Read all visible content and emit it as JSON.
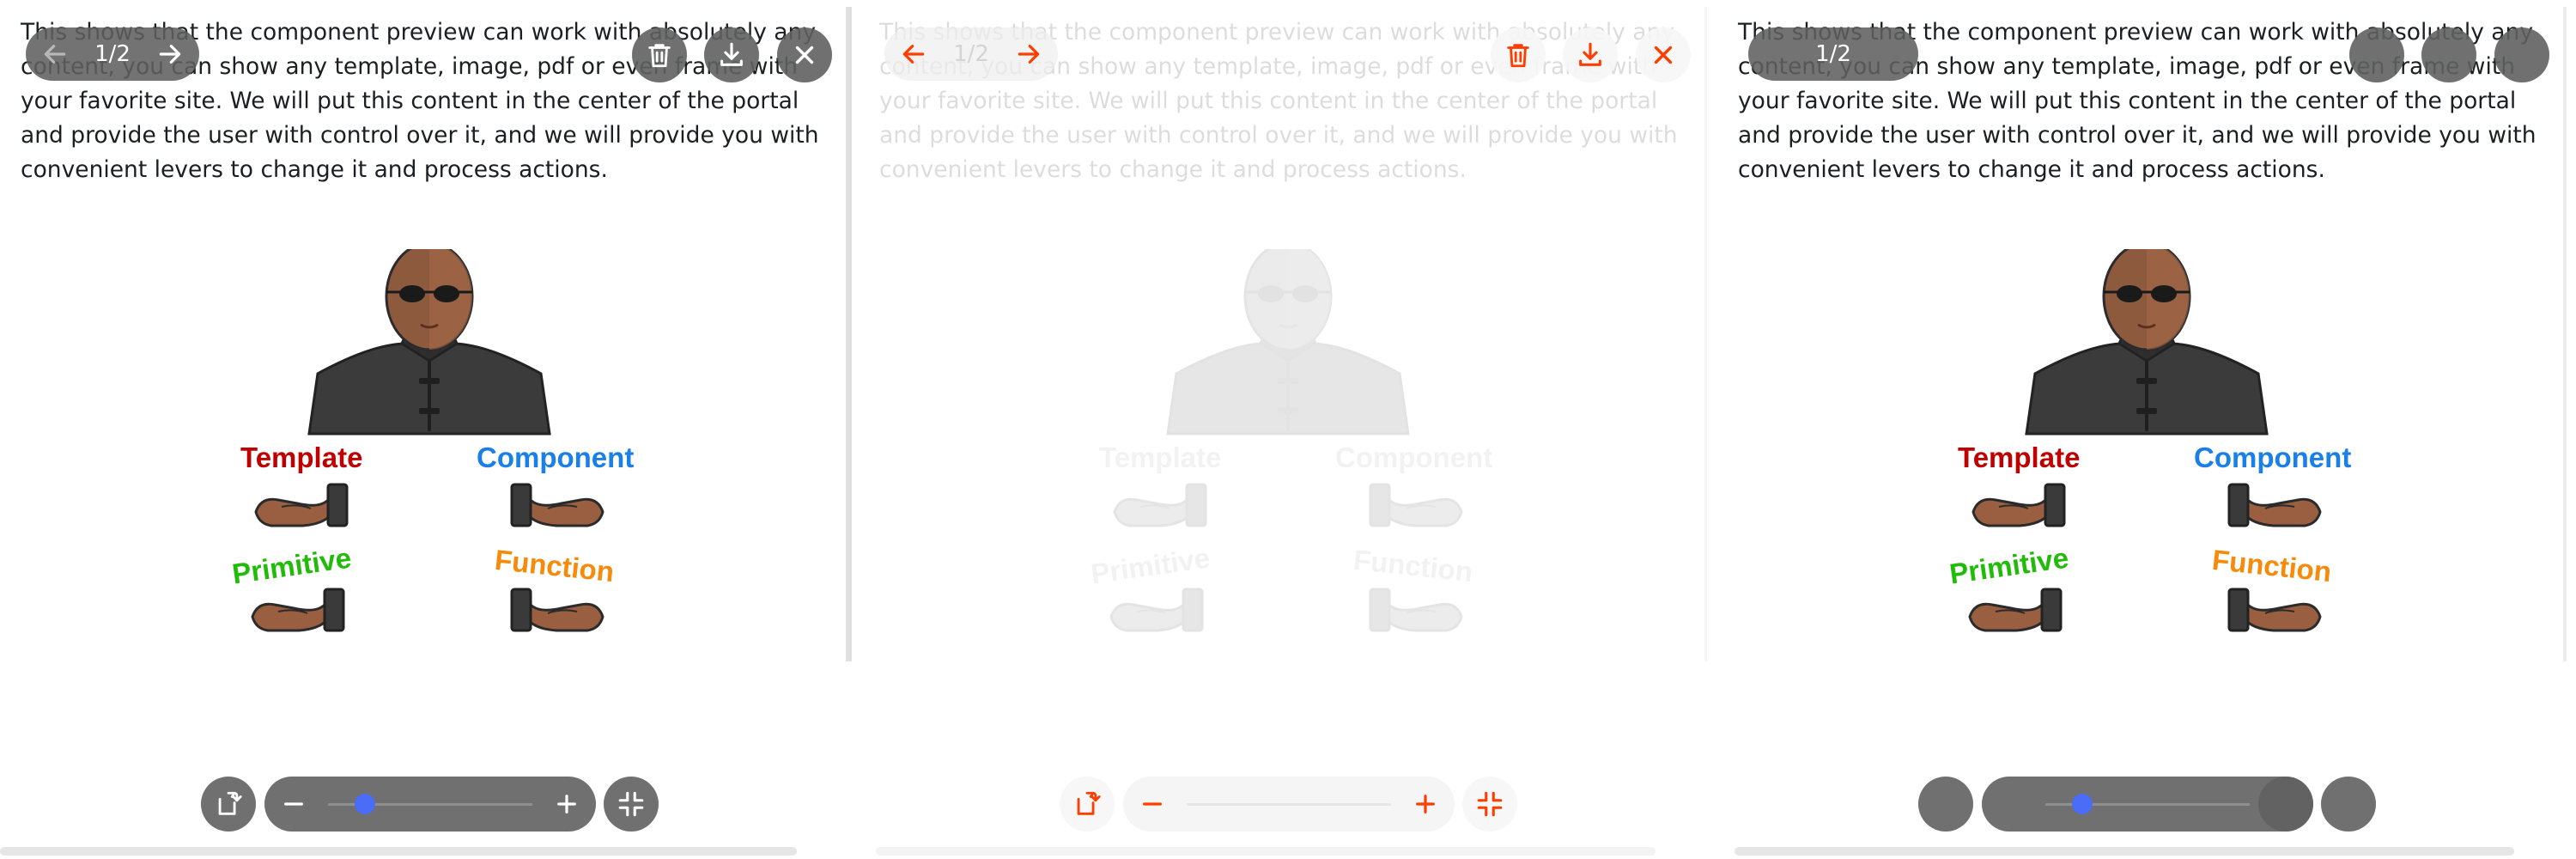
{
  "description": "This shows that the component preview can work with absolutely any content, you can show any template, image, pdf or even frame with your favorite site. We will put this content in the center of the portal and provide the user with control over it, and we will provide you with convenient levers to change it and process actions.",
  "pagination": {
    "current_page": 1,
    "total_pages": 2,
    "label": "1/2"
  },
  "illustration": {
    "labels": [
      {
        "text": "Template",
        "color": "#c00000"
      },
      {
        "text": "Component",
        "color": "#1a7fe8"
      },
      {
        "text": "Primitive",
        "color": "#22bb0a"
      },
      {
        "text": "Function",
        "color": "#f58a0b"
      }
    ]
  },
  "zoom": {
    "level_fraction": 0.18
  },
  "colors": {
    "control_dark": "#606060",
    "accent_orange": "#ff3d00",
    "slider_thumb": "#4a6cf7"
  },
  "icons": {
    "prev": "arrow-left-icon",
    "next": "arrow-right-icon",
    "delete": "trash-icon",
    "download": "download-icon",
    "close": "close-icon",
    "rotate": "rotate-icon",
    "zoom_out": "minus-icon",
    "zoom_in": "plus-icon",
    "collapse": "collapse-icon"
  }
}
